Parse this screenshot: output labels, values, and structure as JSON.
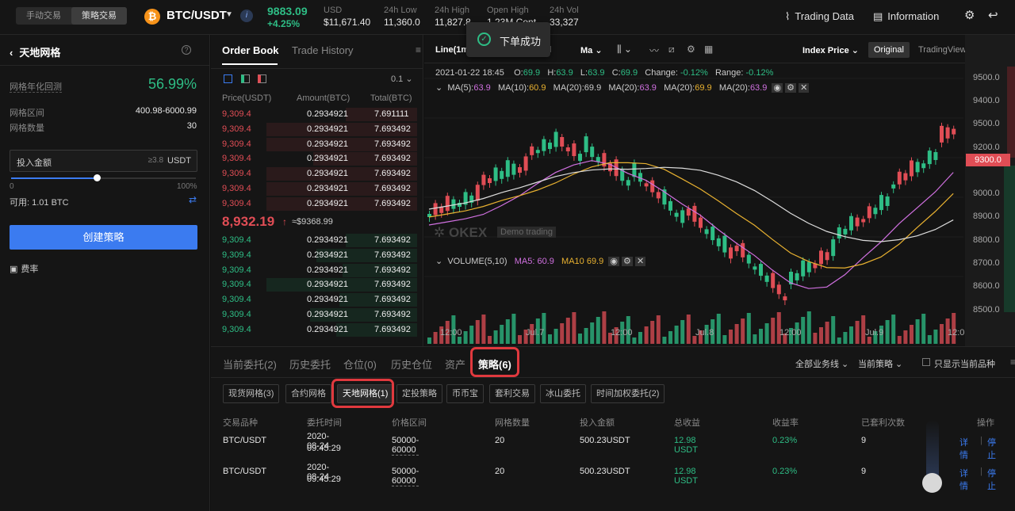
{
  "top": {
    "mode_manual": "手动交易",
    "mode_strategy": "策略交易",
    "coin_icon": "bitcoin-icon",
    "pair": "BTC/USDT",
    "price": "9883.09",
    "change": "+4.25%",
    "usd_label": "USD",
    "usd_value": "$11,671.40",
    "low_label": "24h Low",
    "low_value": "11,360.0",
    "high_label": "24h High",
    "high_value": "11,827.8",
    "open_label": "Open High",
    "open_value": "1.23M Cont",
    "vol_label": "24h Vol",
    "vol_value": "33,327",
    "trading_data": "Trading Data",
    "information": "Information"
  },
  "left": {
    "title": "天地网格",
    "annual_label": "网格年化回测",
    "annual_value": "56.99%",
    "range_label": "网格区间",
    "range_value": "400.98-6000.99",
    "count_label": "网格数量",
    "count_value": "30",
    "amount_placeholder": "投入金额",
    "amount_hint": "≥3.8",
    "amount_unit": "USDT",
    "slider_min": "0",
    "slider_max": "100%",
    "slider_value": 46,
    "available": "可用: 1.01 BTC",
    "create": "创建策略",
    "fee": "费率"
  },
  "orderbook": {
    "tab1": "Order Book",
    "tab2": "Trade History",
    "precision": "0.1",
    "col_price": "Price(USDT)",
    "col_amount": "Amount(BTC)",
    "col_total": "Total(BTC)",
    "asks": [
      {
        "p": "9,309.4",
        "a": "0.2934921",
        "t": "7.691111"
      },
      {
        "p": "9,309.4",
        "a": "0.2934921",
        "t": "7.693492"
      },
      {
        "p": "9,309.4",
        "a": "0.2934921",
        "t": "7.693492"
      },
      {
        "p": "9,309.4",
        "a": "0.2934921",
        "t": "7.693492"
      },
      {
        "p": "9,309.4",
        "a": "0.2934921",
        "t": "7.693492"
      },
      {
        "p": "9,309.4",
        "a": "0.2934921",
        "t": "7.693492"
      },
      {
        "p": "9,309.4",
        "a": "0.2934921",
        "t": "7.693492"
      }
    ],
    "mid": "8,932.19",
    "mid_arrow": "↑",
    "mid_usd": "≈$9368.99",
    "bids": [
      {
        "p": "9,309.4",
        "a": "0.2934921",
        "t": "7.693492"
      },
      {
        "p": "9,309.4",
        "a": "0.2934921",
        "t": "7.693492"
      },
      {
        "p": "9,309.4",
        "a": "0.2934921",
        "t": "7.693492"
      },
      {
        "p": "9,309.4",
        "a": "0.2934921",
        "t": "7.693492"
      },
      {
        "p": "9,309.4",
        "a": "0.2934921",
        "t": "7.693492"
      },
      {
        "p": "9,309.4",
        "a": "0.2934921",
        "t": "7.693492"
      },
      {
        "p": "9,309.4",
        "a": "0.2934921",
        "t": "7.693492"
      }
    ]
  },
  "chart": {
    "interval": "Line(1m",
    "type": "d",
    "ma_menu": "Ma",
    "index_price": "Index Price",
    "view_original": "Original",
    "view_tv": "TradingView",
    "ohlc": {
      "date": "2021-01-22 18:45",
      "o": "O:",
      "ov": "69.9",
      "h": "H:",
      "hv": "63.9",
      "l": "L:",
      "lv": "63.9",
      "c": "C:",
      "cv": "69.9",
      "chg": "Change:",
      "chgv": "-0.12%",
      "rng": "Range:",
      "rngv": "-0.12%"
    },
    "ma": [
      {
        "k": "MA(5):",
        "v": "63.9"
      },
      {
        "k": "MA(10):",
        "v": "60.9"
      },
      {
        "k": "MA(20):",
        "v": "69.9"
      },
      {
        "k": "MA(20):",
        "v": "63.9"
      },
      {
        "k": "MA(20):",
        "v": "69.9"
      },
      {
        "k": "MA(20):",
        "v": "63.9"
      }
    ],
    "volume_label": "VOLUME(5,10)",
    "ma5": "MA5: 60.9",
    "ma10": "MA10 69.9",
    "y_ticks": [
      "9500.0",
      "9400.0",
      "9500.0",
      "9200.0",
      "9000.0",
      "8900.0",
      "8800.0",
      "8700.0",
      "8600.0",
      "8500.0"
    ],
    "price_tag": "9300.0",
    "x_ticks": [
      "12:00",
      "Jul.7",
      "12:00",
      "Jul.8",
      "12:00",
      "Jul.9",
      "12:0"
    ],
    "watermark": "OKEX",
    "watermark_sub": "Demo trading"
  },
  "toast": {
    "text": "下单成功"
  },
  "bottom": {
    "tabs": [
      "当前委托(2)",
      "历史委托",
      "仓位(0)",
      "历史仓位",
      "资产",
      "策略(6)"
    ],
    "filter_biz": "全部业务线",
    "filter_strategy": "当前策略",
    "only_current": "只显示当前品种",
    "subtabs": [
      "现货网格(3)",
      "合约网格",
      "天地网格(1)",
      "定投策略",
      "币币宝",
      "套利交易",
      "冰山委托",
      "时间加权委托(2)"
    ],
    "headers": [
      "交易品种",
      "委托时间",
      "价格区间",
      "网格数量",
      "投入金额",
      "总收益",
      "收益率",
      "已套利次数",
      "操作"
    ],
    "rows": [
      {
        "pair": "BTC/USDT",
        "date": "2020-08-24",
        "time": "09:45:29",
        "range": "50000-60000",
        "grids": "20",
        "amount": "500.23USDT",
        "profit": "12.98 USDT",
        "rate": "0.23%",
        "count": "9",
        "detail": "详情",
        "stop": "停止"
      },
      {
        "pair": "BTC/USDT",
        "date": "2020-08-24",
        "time": "09:45:29",
        "range": "50000-60000",
        "grids": "20",
        "amount": "500.23USDT",
        "profit": "12.98 USDT",
        "rate": "0.23%",
        "count": "9",
        "detail": "详情",
        "stop": "停止"
      }
    ]
  },
  "colors": {
    "up": "#2ebd85",
    "down": "#e04d55",
    "accent": "#3b7bf0",
    "highlight": "#e0393e"
  }
}
